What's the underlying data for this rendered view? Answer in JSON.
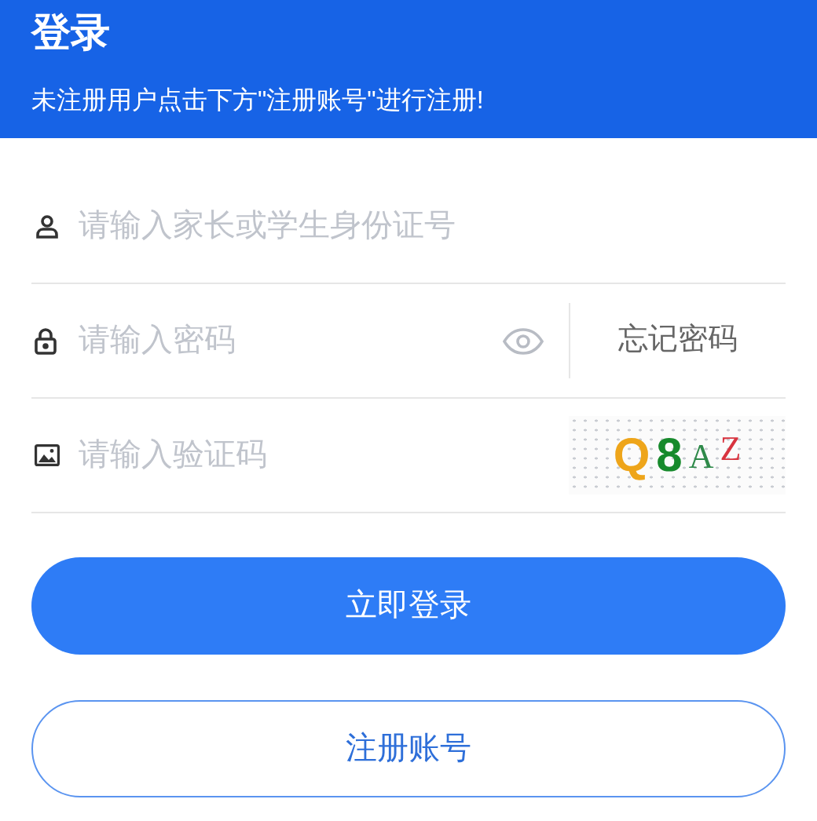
{
  "header": {
    "title": "登录",
    "subtitle": "未注册用户点击下方\"注册账号\"进行注册!"
  },
  "fields": [
    {
      "kind": "account",
      "placeholder": "请输入家长或学生身份证号"
    },
    {
      "kind": "password",
      "placeholder": "请输入密码",
      "forgot_link": "忘记密码"
    },
    {
      "kind": "captcha",
      "placeholder": "请输入验证码",
      "captcha": [
        {
          "char": "Q",
          "color": "#eea51a"
        },
        {
          "char": "8",
          "color": "#178a2c"
        },
        {
          "char": "A",
          "color": "#2f8a4a"
        },
        {
          "char": "Z",
          "color": "#d8343f"
        }
      ]
    }
  ],
  "buttons": [
    {
      "kind": "primary",
      "label": "立即登录"
    },
    {
      "kind": "outline",
      "label": "注册账号"
    }
  ]
}
